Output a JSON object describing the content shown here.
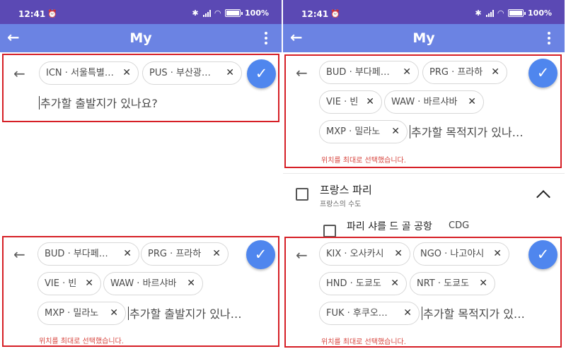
{
  "status": {
    "time": "12:41",
    "alarm_icon": "alarm-icon",
    "battery": "100%"
  },
  "appbar": {
    "title": "My",
    "back_icon": "arrow-back-icon",
    "more_icon": "more-vert-icon"
  },
  "left": {
    "origin_panel": {
      "chips": [
        {
          "code": "ICN · 서울특별…"
        },
        {
          "code": "PUS · 부산광…"
        }
      ],
      "input_placeholder": "추가할 출발지가 있나요?"
    },
    "destination_panel": {
      "chips": [
        {
          "code": "BUD · 부다페…"
        },
        {
          "code": "PRG · 프라하"
        },
        {
          "code": "VIE · 빈"
        },
        {
          "code": "WAW · 바르샤바"
        },
        {
          "code": "MXP · 밀라노"
        }
      ],
      "input_placeholder": "추가할 출발지가 있나…",
      "error": "위치를 최대로 선택했습니다."
    }
  },
  "right": {
    "destination_panel": {
      "chips": [
        {
          "code": "BUD · 부다페…"
        },
        {
          "code": "PRG · 프라하"
        },
        {
          "code": "VIE · 빈"
        },
        {
          "code": "WAW · 바르샤바"
        },
        {
          "code": "MXP · 밀라노"
        }
      ],
      "input_placeholder": "추가할 목적지가 있나…",
      "error": "위치를 최대로 선택했습니다."
    },
    "list": {
      "city_title": "프랑스 파리",
      "city_subtitle": "프랑스의 수도",
      "airport_name": "파리 샤를 드 골 공항",
      "airport_code": "CDG"
    },
    "japan_panel": {
      "chips": [
        {
          "code": "KIX · 오사카시"
        },
        {
          "code": "NGO · 나고야시"
        },
        {
          "code": "HND · 도쿄도"
        },
        {
          "code": "NRT · 도쿄도"
        },
        {
          "code": "FUK · 후쿠오…"
        }
      ],
      "input_placeholder": "추가할 목적지가 있…",
      "error": "위치를 최대로 선택했습니다."
    }
  },
  "icons": {
    "chip_close": "×",
    "back": "←",
    "check": "✓"
  },
  "colors": {
    "statusbar": "#5b49b4",
    "appbar": "#6b83e3",
    "highlight_border": "#d61f26",
    "fab": "#4f86ee",
    "error": "#d84841"
  }
}
